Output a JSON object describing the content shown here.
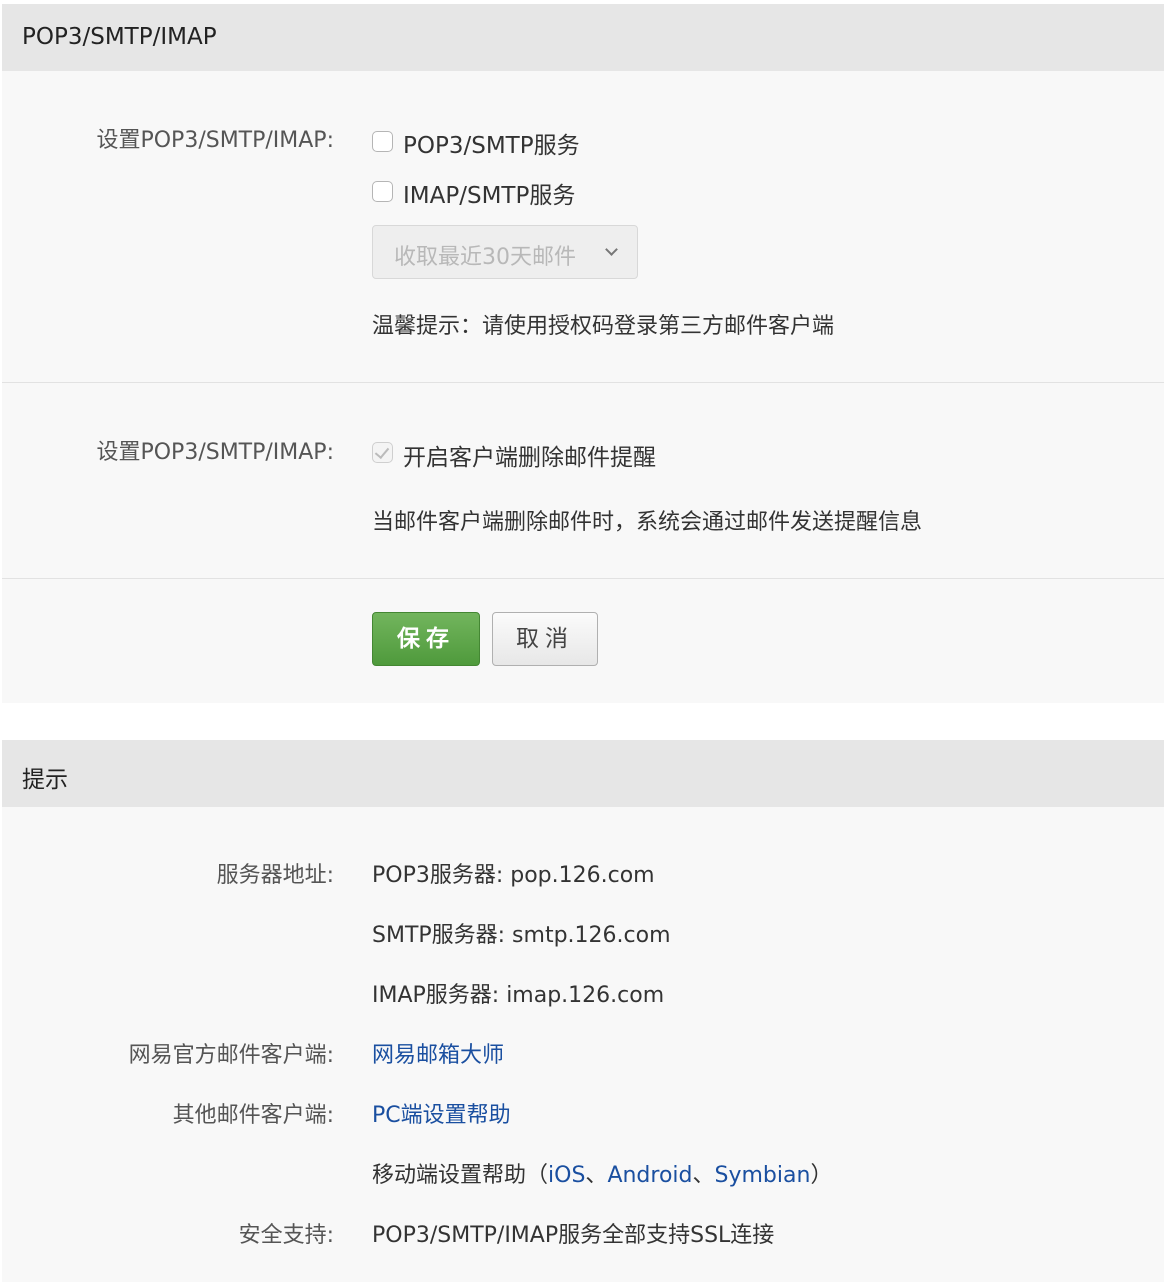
{
  "settings": {
    "title": "POP3/SMTP/IMAP",
    "row1_label": "设置POP3/SMTP/IMAP:",
    "pop3_service_label": "POP3/SMTP服务",
    "pop3_checked": false,
    "imap_service_label": "IMAP/SMTP服务",
    "imap_checked": false,
    "fetch_range_select": "收取最近30天邮件",
    "tip": "温馨提示：请使用授权码登录第三方邮件客户端",
    "row2_label": "设置POP3/SMTP/IMAP:",
    "delete_alert_label": "开启客户端删除邮件提醒",
    "delete_alert_checked": true,
    "delete_alert_desc": "当邮件客户端删除邮件时，系统会通过邮件发送提醒信息",
    "save_label": "保存",
    "cancel_label": "取消"
  },
  "tips": {
    "title": "提示",
    "server_label": "服务器地址:",
    "pop3_server": "POP3服务器: pop.126.com",
    "smtp_server": "SMTP服务器: smtp.126.com",
    "imap_server": "IMAP服务器: imap.126.com",
    "official_client_label": "网易官方邮件客户端:",
    "official_client_link": "网易邮箱大师",
    "other_client_label": "其他邮件客户端:",
    "pc_help_link": "PC端设置帮助",
    "mobile_help_prefix": "移动端设置帮助（",
    "ios_link": "iOS",
    "sep1": "、",
    "android_link": "Android",
    "sep2": "、",
    "symbian_link": "Symbian",
    "mobile_help_suffix": "）",
    "security_label": "安全支持:",
    "security_text": "POP3/SMTP/IMAP服务全部支持SSL连接"
  }
}
